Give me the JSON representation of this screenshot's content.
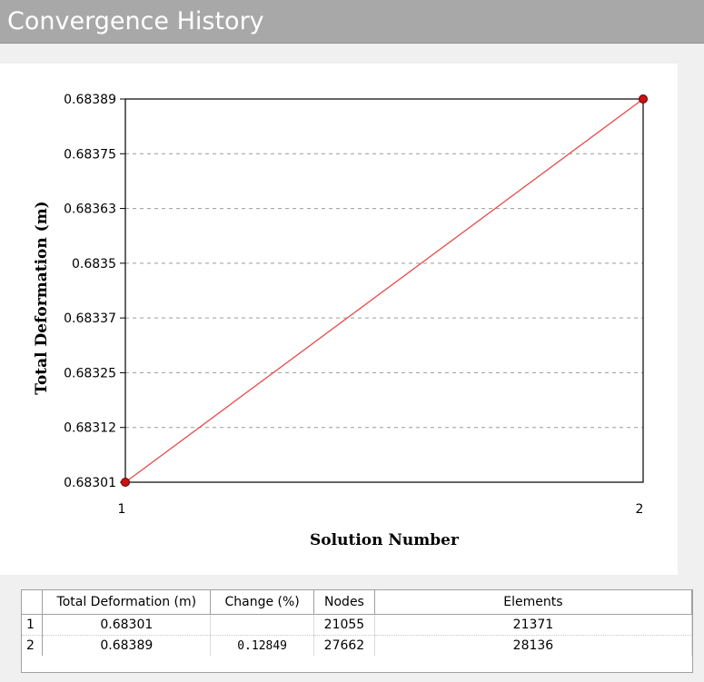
{
  "window": {
    "title": "Convergence History"
  },
  "chart_data": {
    "type": "line",
    "xlabel": "Solution Number",
    "ylabel": "Total Deformation  (m)",
    "x": [
      1,
      2
    ],
    "x_ticks": [
      "1",
      "2"
    ],
    "y_ticks": [
      "0.68389",
      "0.68375",
      "0.68363",
      "0.6835",
      "0.68337",
      "0.68325",
      "0.68312",
      "0.68301"
    ],
    "ylim": [
      0.68301,
      0.68389
    ],
    "grid": true,
    "series": [
      {
        "values": [
          0.68301,
          0.68389
        ],
        "color": "#e84a4a",
        "marker_color": "#cc1111"
      }
    ]
  },
  "table": {
    "headers": [
      "",
      "Total Deformation (m)",
      "Change (%)",
      "Nodes",
      "Elements"
    ],
    "rows": [
      [
        "1",
        "0.68301",
        "",
        "21055",
        "21371"
      ],
      [
        "2",
        "0.68389",
        "0.12849",
        "27662",
        "28136"
      ]
    ]
  }
}
